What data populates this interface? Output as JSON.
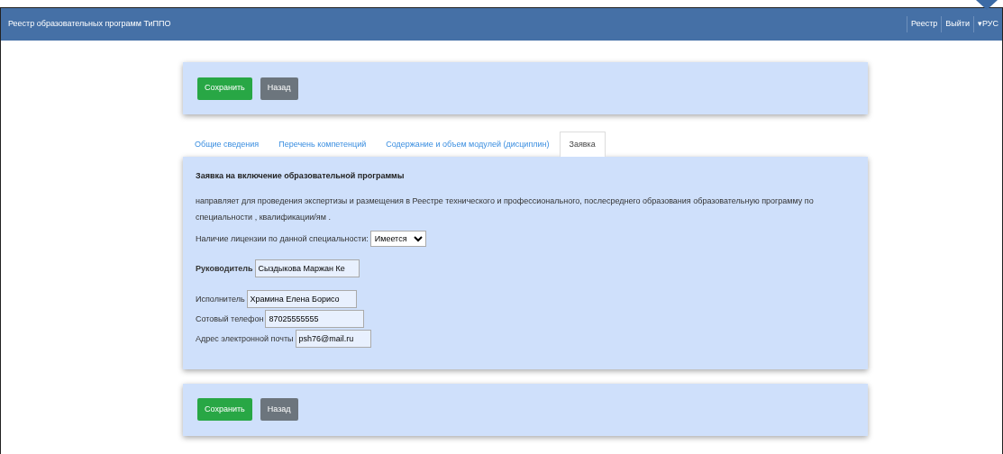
{
  "navbar": {
    "brand": "Реестр образовательных программ ТиППО",
    "links": [
      {
        "label": "Реестр"
      },
      {
        "label": "Выйти"
      },
      {
        "label": "▾РУС"
      }
    ]
  },
  "top_actions": {
    "buttons": [
      {
        "label": "Сохранить",
        "kind": "save"
      },
      {
        "label": "Назад",
        "kind": "back"
      }
    ]
  },
  "tabs": [
    {
      "label": "Общие сведения",
      "selected": false
    },
    {
      "label": "Перечень компетенций",
      "selected": false
    },
    {
      "label": "Содержание и объем модулей (дисциплин)",
      "selected": false
    },
    {
      "label": "Заявка",
      "selected": true
    }
  ],
  "form": {
    "heading": "Заявка на включение образовательной программы",
    "description": "направляет для проведения экспертизы и размещения в Реестре технического и профессионального, послесреднего образования образовательную программу по специальности , квалификации/ям .",
    "license": {
      "label": "Наличие лицензии по данной специальности:",
      "value": "Имеется"
    },
    "fields": [
      {
        "label": "Руководитель",
        "value": "Сыздыкова Маржан Ке",
        "bold": true
      },
      {
        "label": "Исполнитель",
        "value": "Храмина Елена Борисо",
        "bold": false
      },
      {
        "label": "Сотовый телефон",
        "value": "87025555555",
        "bold": false
      },
      {
        "label": "Адрес электронной почты",
        "value": "psh76@mail.ru",
        "bold": false
      }
    ]
  },
  "bottom_actions": {
    "buttons": [
      {
        "label": "Сохранить",
        "kind": "save"
      },
      {
        "label": "Назад",
        "kind": "back"
      }
    ]
  }
}
